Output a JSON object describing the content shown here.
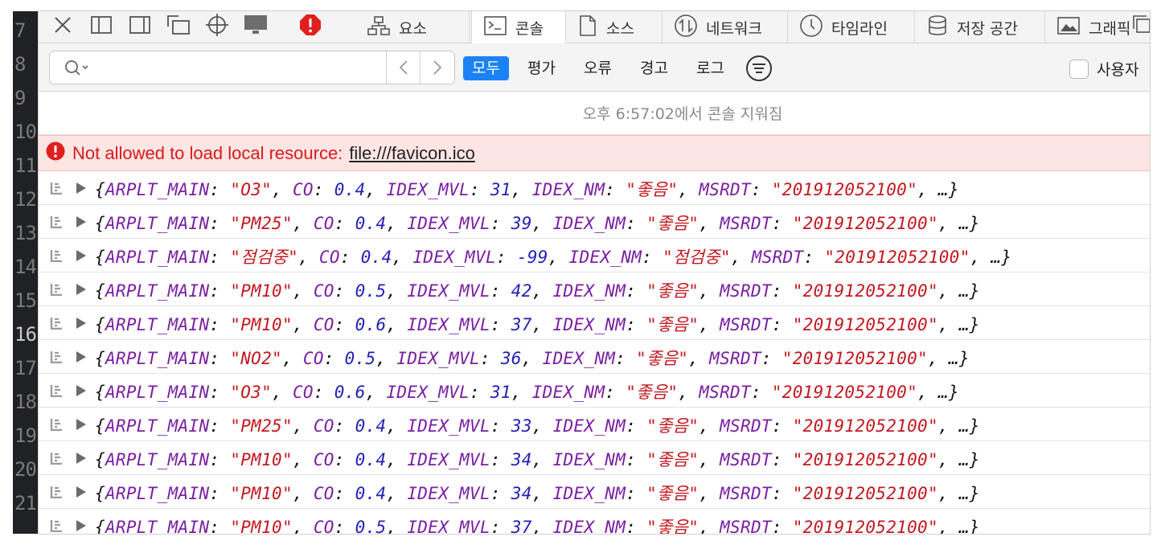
{
  "gutter": {
    "numbers": [
      "7",
      "8",
      "9",
      "10",
      "11",
      "12",
      "13",
      "14",
      "15",
      "16",
      "17",
      "18",
      "19",
      "20",
      "21"
    ],
    "current": "16"
  },
  "toolbar_icons": [
    "close-icon",
    "dock-bottom-icon",
    "dock-side-icon",
    "detach-icon",
    "element-picker-icon",
    "device-icon",
    "error-badge-icon"
  ],
  "tabs": [
    {
      "label": "요소",
      "icon": "elements-icon",
      "active": false
    },
    {
      "label": "콘솔",
      "icon": "console-icon",
      "active": true
    },
    {
      "label": "소스",
      "icon": "sources-icon",
      "active": false
    },
    {
      "label": "네트워크",
      "icon": "network-icon",
      "active": false
    },
    {
      "label": "타임라인",
      "icon": "timeline-icon",
      "active": false
    },
    {
      "label": "저장 공간",
      "icon": "storage-icon",
      "active": false
    },
    {
      "label": "그래픽",
      "icon": "graphics-icon",
      "active": false
    }
  ],
  "filter": {
    "search_value": "",
    "levels": [
      "모두",
      "평가",
      "오류",
      "경고",
      "로그"
    ],
    "selected_level": "모두",
    "user_checkbox_label": "사용자 ",
    "accent": "#1a82f5"
  },
  "console": {
    "cleared_message": "오후 6:57:02에서 콘솔 지워짐",
    "error": {
      "text": "Not allowed to load local resource:",
      "link": "file:///favicon.ico",
      "color": "#d9191a"
    },
    "entries": [
      {
        "ARPLT_MAIN": "O3",
        "CO": "0.4",
        "IDEX_MVL": "31",
        "IDEX_NM": "좋음",
        "MSRDT": "201912052100"
      },
      {
        "ARPLT_MAIN": "PM25",
        "CO": "0.4",
        "IDEX_MVL": "39",
        "IDEX_NM": "좋음",
        "MSRDT": "201912052100"
      },
      {
        "ARPLT_MAIN": "점검중",
        "CO": "0.4",
        "IDEX_MVL": "-99",
        "IDEX_NM": "점검중",
        "MSRDT": "201912052100"
      },
      {
        "ARPLT_MAIN": "PM10",
        "CO": "0.5",
        "IDEX_MVL": "42",
        "IDEX_NM": "좋음",
        "MSRDT": "201912052100"
      },
      {
        "ARPLT_MAIN": "PM10",
        "CO": "0.6",
        "IDEX_MVL": "37",
        "IDEX_NM": "좋음",
        "MSRDT": "201912052100"
      },
      {
        "ARPLT_MAIN": "NO2",
        "CO": "0.5",
        "IDEX_MVL": "36",
        "IDEX_NM": "좋음",
        "MSRDT": "201912052100"
      },
      {
        "ARPLT_MAIN": "O3",
        "CO": "0.6",
        "IDEX_MVL": "31",
        "IDEX_NM": "좋음",
        "MSRDT": "201912052100"
      },
      {
        "ARPLT_MAIN": "PM25",
        "CO": "0.4",
        "IDEX_MVL": "33",
        "IDEX_NM": "좋음",
        "MSRDT": "201912052100"
      },
      {
        "ARPLT_MAIN": "PM10",
        "CO": "0.4",
        "IDEX_MVL": "34",
        "IDEX_NM": "좋음",
        "MSRDT": "201912052100"
      },
      {
        "ARPLT_MAIN": "PM10",
        "CO": "0.4",
        "IDEX_MVL": "34",
        "IDEX_NM": "좋음",
        "MSRDT": "201912052100"
      },
      {
        "ARPLT_MAIN": "PM10",
        "CO": "0.5",
        "IDEX_MVL": "37",
        "IDEX_NM": "좋음",
        "MSRDT": "201912052100"
      }
    ],
    "ellipsis": "…",
    "colors": {
      "key": "#7a1fa2",
      "string": "#c2181f",
      "number": "#2420b6"
    }
  }
}
